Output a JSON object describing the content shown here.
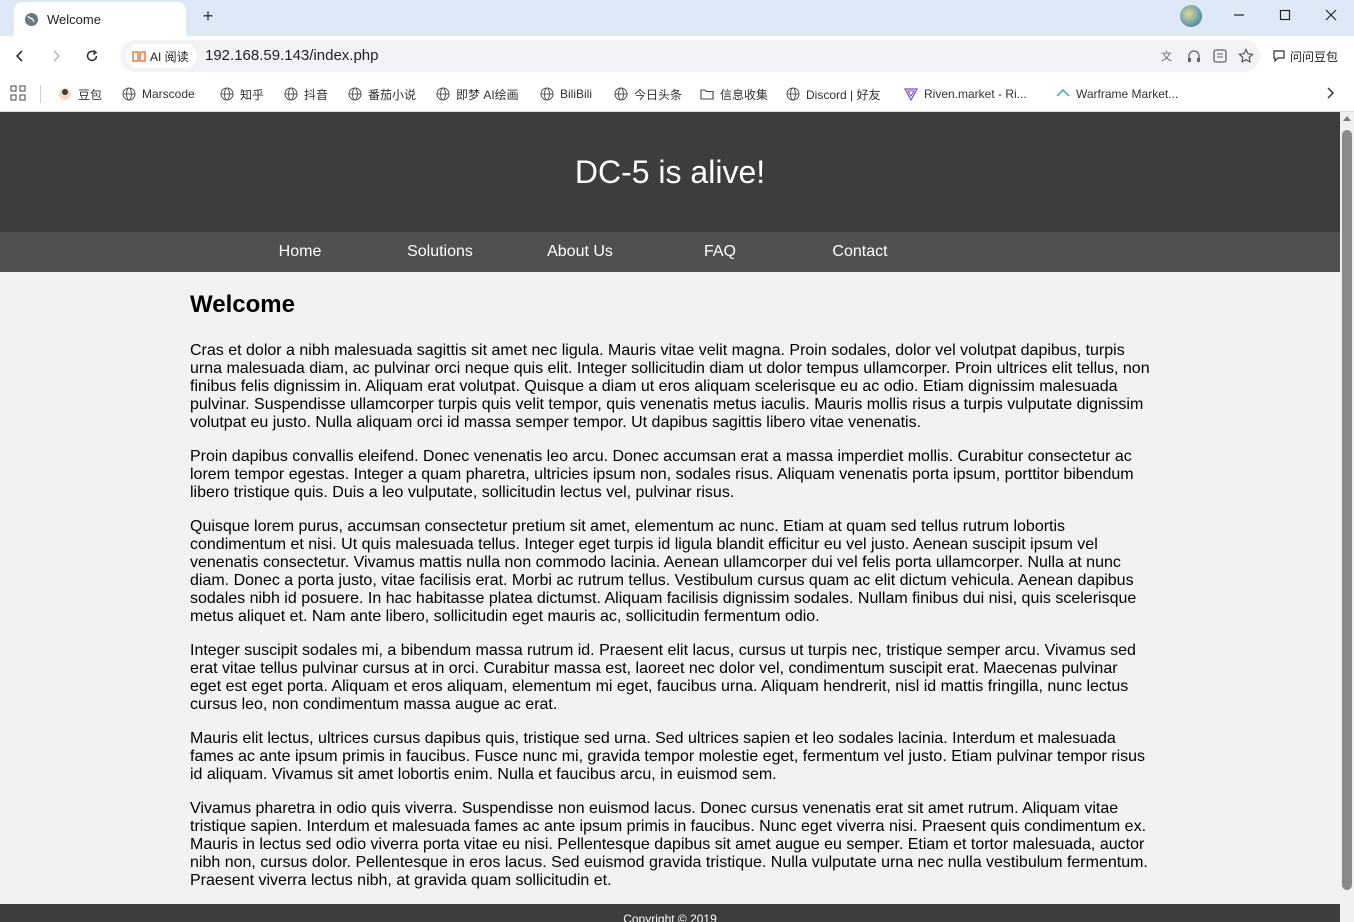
{
  "browser": {
    "tab": {
      "title": "Welcome"
    },
    "new_tab_label": "+",
    "window_controls": {
      "minimize": "—",
      "maximize": "☐",
      "close": "✕"
    },
    "toolbar": {
      "ai_read_label": "AI 阅读",
      "url": "192.168.59.143/index.php",
      "ask_doubao_label": "问问豆包"
    },
    "bookmarks": [
      {
        "label": "豆包",
        "icon": "doubao-icon"
      },
      {
        "label": "Marscode",
        "icon": "globe-icon"
      },
      {
        "label": "知乎",
        "icon": "globe-icon"
      },
      {
        "label": "抖音",
        "icon": "globe-icon"
      },
      {
        "label": "番茄小说",
        "icon": "globe-icon"
      },
      {
        "label": "即梦 AI绘画",
        "icon": "globe-icon"
      },
      {
        "label": "BiliBili",
        "icon": "globe-icon"
      },
      {
        "label": "今日头条",
        "icon": "globe-icon"
      },
      {
        "label": "信息收集",
        "icon": "folder-icon"
      },
      {
        "label": "Discord | 好友",
        "icon": "globe-icon"
      },
      {
        "label": "Riven.market - Ri...",
        "icon": "riven-icon"
      },
      {
        "label": "Warframe Market...",
        "icon": "warframe-icon"
      }
    ]
  },
  "site": {
    "header_title": "DC-5 is alive!",
    "nav": [
      "Home",
      "Solutions",
      "About Us",
      "FAQ",
      "Contact"
    ],
    "heading": "Welcome",
    "paragraphs": [
      "Cras et dolor a nibh malesuada sagittis sit amet nec ligula. Mauris vitae velit magna. Proin sodales, dolor vel volutpat dapibus, turpis urna malesuada diam, ac pulvinar orci neque quis elit. Integer sollicitudin diam ut dolor tempus ullamcorper. Proin ultrices elit tellus, non finibus felis dignissim in. Aliquam erat volutpat. Quisque a diam ut eros aliquam scelerisque eu ac odio. Etiam dignissim malesuada pulvinar. Suspendisse ullamcorper turpis quis velit tempor, quis venenatis metus iaculis. Mauris mollis risus a turpis vulputate dignissim volutpat eu justo. Nulla aliquam orci id massa semper tempor. Ut dapibus sagittis libero vitae venenatis.",
      "Proin dapibus convallis eleifend. Donec venenatis leo arcu. Donec accumsan erat a massa imperdiet mollis. Curabitur consectetur ac lorem tempor egestas. Integer a quam pharetra, ultricies ipsum non, sodales risus. Aliquam venenatis porta ipsum, porttitor bibendum libero tristique quis. Duis a leo vulputate, sollicitudin lectus vel, pulvinar risus.",
      "Quisque lorem purus, accumsan consectetur pretium sit amet, elementum ac nunc. Etiam at quam sed tellus rutrum lobortis condimentum et nisi. Ut quis malesuada tellus. Integer eget turpis id ligula blandit efficitur eu vel justo. Aenean suscipit ipsum vel venenatis consectetur. Vivamus mattis nulla non commodo lacinia. Aenean ullamcorper dui vel felis porta ullamcorper. Nulla at nunc diam. Donec a porta justo, vitae facilisis erat. Morbi ac rutrum tellus. Vestibulum cursus quam ac elit dictum vehicula. Aenean dapibus sodales nibh id posuere. In hac habitasse platea dictumst. Aliquam facilisis dignissim sodales. Nullam finibus dui nisi, quis scelerisque metus aliquet et. Nam ante libero, sollicitudin eget mauris ac, sollicitudin fermentum odio.",
      "Integer suscipit sodales mi, a bibendum massa rutrum id. Praesent elit lacus, cursus ut turpis nec, tristique semper arcu. Vivamus sed erat vitae tellus pulvinar cursus at in orci. Curabitur massa est, laoreet nec dolor vel, condimentum suscipit erat. Maecenas pulvinar eget est eget porta. Aliquam et eros aliquam, elementum mi eget, faucibus urna. Aliquam hendrerit, nisl id mattis fringilla, nunc lectus cursus leo, non condimentum massa augue ac erat.",
      "Mauris elit lectus, ultrices cursus dapibus quis, tristique sed urna. Sed ultrices sapien et leo sodales lacinia. Interdum et malesuada fames ac ante ipsum primis in faucibus. Fusce nunc mi, gravida tempor molestie eget, fermentum vel justo. Etiam pulvinar tempor risus id aliquam. Vivamus sit amet lobortis enim. Nulla et faucibus arcu, in euismod sem.",
      "Vivamus pharetra in odio quis viverra. Suspendisse non euismod lacus. Donec cursus venenatis erat sit amet rutrum. Aliquam vitae tristique sapien. Interdum et malesuada fames ac ante ipsum primis in faucibus. Nunc eget viverra nisi. Praesent quis condimentum ex. Mauris in lectus sed odio viverra porta vitae eu nisi. Pellentesque dapibus sit amet augue eu semper. Etiam et tortor malesuada, auctor nibh non, cursus dolor. Pellentesque in eros lacus. Sed euismod gravida tristique. Nulla vulputate urna nec nulla vestibulum fermentum. Praesent viverra lectus nibh, at gravida quam sollicitudin et."
    ],
    "footer_text": "Copyright © 2019"
  },
  "colors": {
    "header_bg": "#3d3d3d",
    "nav_bg": "#505050",
    "content_bg": "#f2f2f2",
    "tabbar_bg": "#dfe8f6"
  }
}
